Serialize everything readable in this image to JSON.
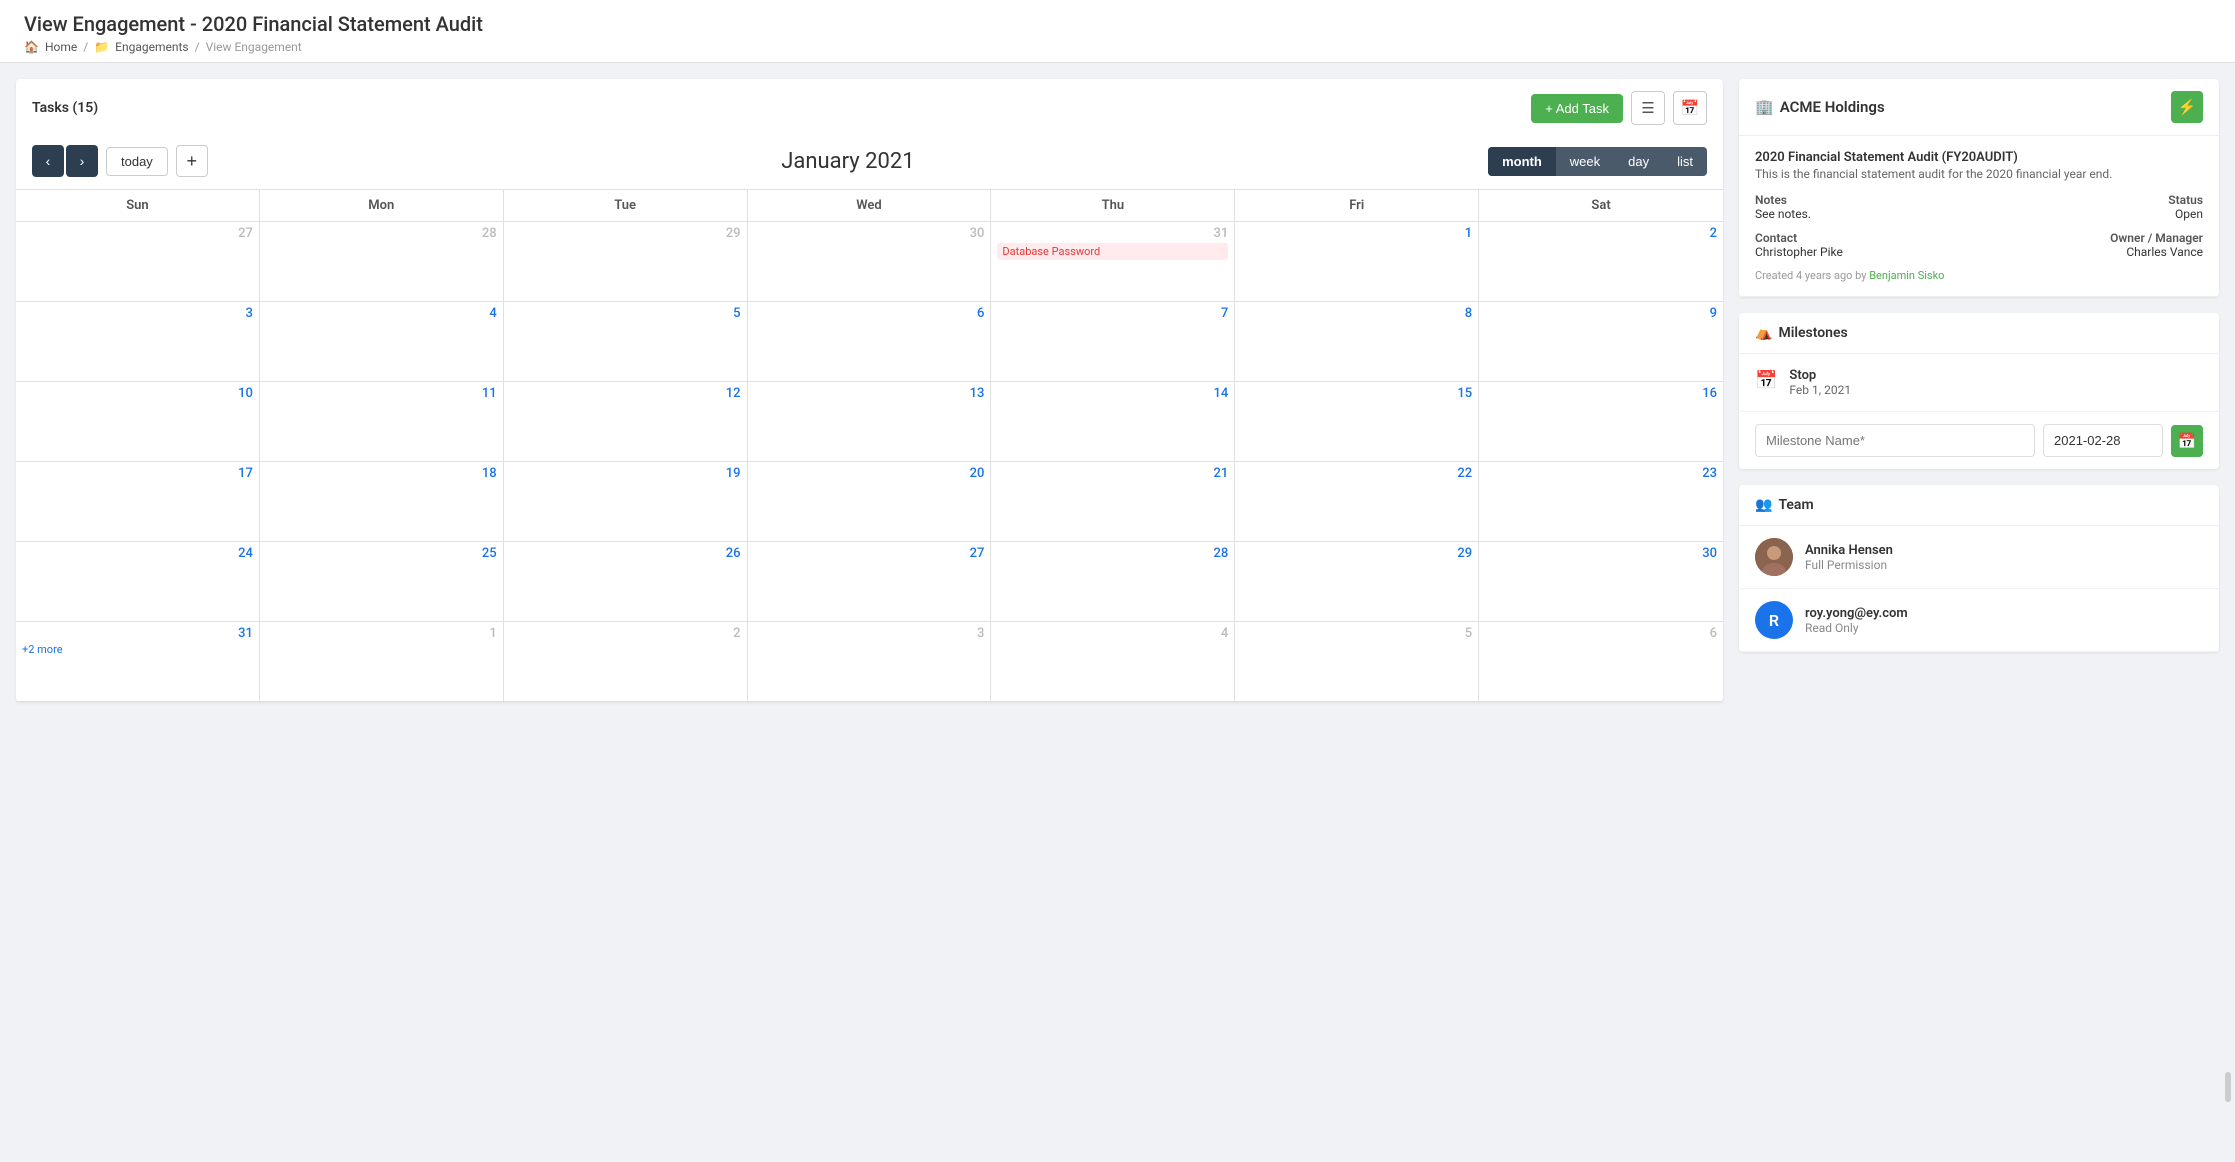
{
  "header": {
    "title": "View Engagement - 2020 Financial Statement Audit",
    "breadcrumb": [
      {
        "label": "Home",
        "icon": "home-icon"
      },
      {
        "label": "Engagements",
        "icon": "briefcase-icon"
      },
      {
        "label": "View Engagement",
        "icon": null
      }
    ]
  },
  "tasks": {
    "title": "Tasks (15)",
    "add_task_label": "+ Add Task",
    "calendar": {
      "month": "January 2021",
      "nav": {
        "prev": "‹",
        "next": "›",
        "today": "today",
        "plus": "+"
      },
      "views": [
        "month",
        "week",
        "day",
        "list"
      ],
      "active_view": "month",
      "day_headers": [
        "Sun",
        "Mon",
        "Tue",
        "Wed",
        "Thu",
        "Fri",
        "Sat"
      ],
      "weeks": [
        [
          {
            "date": "27",
            "other": true,
            "events": []
          },
          {
            "date": "28",
            "other": true,
            "events": []
          },
          {
            "date": "29",
            "other": true,
            "events": []
          },
          {
            "date": "30",
            "other": true,
            "events": []
          },
          {
            "date": "31",
            "other": true,
            "events": [
              {
                "label": "Database Password",
                "color": "red"
              }
            ]
          },
          {
            "date": "1",
            "events": []
          },
          {
            "date": "2",
            "events": []
          }
        ],
        [
          {
            "date": "3",
            "events": []
          },
          {
            "date": "4",
            "events": []
          },
          {
            "date": "5",
            "events": []
          },
          {
            "date": "6",
            "events": []
          },
          {
            "date": "7",
            "events": []
          },
          {
            "date": "8",
            "events": []
          },
          {
            "date": "9",
            "events": []
          }
        ],
        [
          {
            "date": "10",
            "events": []
          },
          {
            "date": "11",
            "events": []
          },
          {
            "date": "12",
            "events": []
          },
          {
            "date": "13",
            "events": []
          },
          {
            "date": "14",
            "events": []
          },
          {
            "date": "15",
            "events": []
          },
          {
            "date": "16",
            "events": []
          }
        ],
        [
          {
            "date": "17",
            "events": []
          },
          {
            "date": "18",
            "events": []
          },
          {
            "date": "19",
            "events": []
          },
          {
            "date": "20",
            "events": []
          },
          {
            "date": "21",
            "events": []
          },
          {
            "date": "22",
            "events": []
          },
          {
            "date": "23",
            "events": []
          }
        ],
        [
          {
            "date": "24",
            "events": []
          },
          {
            "date": "25",
            "events": []
          },
          {
            "date": "26",
            "events": []
          },
          {
            "date": "27",
            "events": []
          },
          {
            "date": "28",
            "events": []
          },
          {
            "date": "29",
            "events": []
          },
          {
            "date": "30",
            "events": []
          }
        ],
        [
          {
            "date": "31",
            "events": [],
            "more": "+2 more"
          },
          {
            "date": "1",
            "other": true,
            "events": []
          },
          {
            "date": "2",
            "other": true,
            "events": []
          },
          {
            "date": "3",
            "other": true,
            "events": []
          },
          {
            "date": "4",
            "other": true,
            "events": []
          },
          {
            "date": "5",
            "other": true,
            "events": []
          },
          {
            "date": "6",
            "other": true,
            "events": []
          }
        ]
      ]
    }
  },
  "sidebar": {
    "company": "ACME Holdings",
    "engagement": {
      "name": "2020 Financial Statement Audit (FY20AUDIT)",
      "description": "This is the financial statement audit for the 2020 financial year end.",
      "notes_label": "Notes",
      "notes_value": "See notes.",
      "status_label": "Status",
      "status_value": "Open",
      "contact_label": "Contact",
      "contact_value": "Christopher Pike",
      "owner_label": "Owner / Manager",
      "owner_value": "Charles Vance",
      "created_text": "Created 4 years ago by",
      "created_by": "Benjamin Sisko"
    },
    "milestones": {
      "title": "Milestones",
      "items": [
        {
          "name": "Stop",
          "date": "Feb 1, 2021"
        }
      ],
      "form": {
        "name_placeholder": "Milestone Name*",
        "date_value": "2021-02-28"
      }
    },
    "team": {
      "title": "Team",
      "members": [
        {
          "name": "Annika Hensen",
          "role": "Full Permission",
          "avatar_type": "photo",
          "color": "#8B4513"
        },
        {
          "name": "roy.yong@ey.com",
          "role": "Read Only",
          "avatar_type": "initial",
          "initial": "R",
          "color": "#1a73e8"
        }
      ]
    }
  }
}
